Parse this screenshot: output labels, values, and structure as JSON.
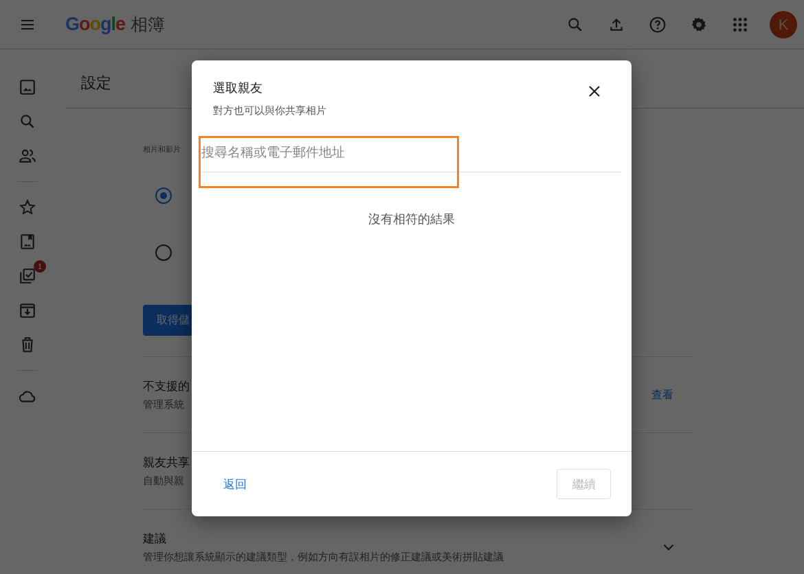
{
  "header": {
    "logo": "Google",
    "title": "相簿",
    "avatar": "K"
  },
  "sidebar": {
    "badge": "1"
  },
  "page": {
    "title": "設定",
    "section_label": "相片和影片",
    "radios": [
      {
        "selected": true
      },
      {
        "selected": false
      }
    ],
    "button": "取得儲",
    "rows": [
      {
        "title": "不支援的",
        "description": "管理系統",
        "action": "查看"
      },
      {
        "title": "親友共享",
        "description": "自動與親"
      },
      {
        "title": "建議",
        "description": "管理你想讓系統顯示的建議類型，例如方向有誤相片的修正建議或美術拼貼建議",
        "expanded": false
      }
    ]
  },
  "dialog": {
    "title": "選取親友",
    "subtitle": "對方也可以與你共享相片",
    "search": {
      "placeholder": "搜尋名稱或電子郵件地址"
    },
    "empty_message": "沒有相符的結果",
    "back": "返回",
    "continue": {
      "label": "繼續",
      "disabled": true
    }
  }
}
